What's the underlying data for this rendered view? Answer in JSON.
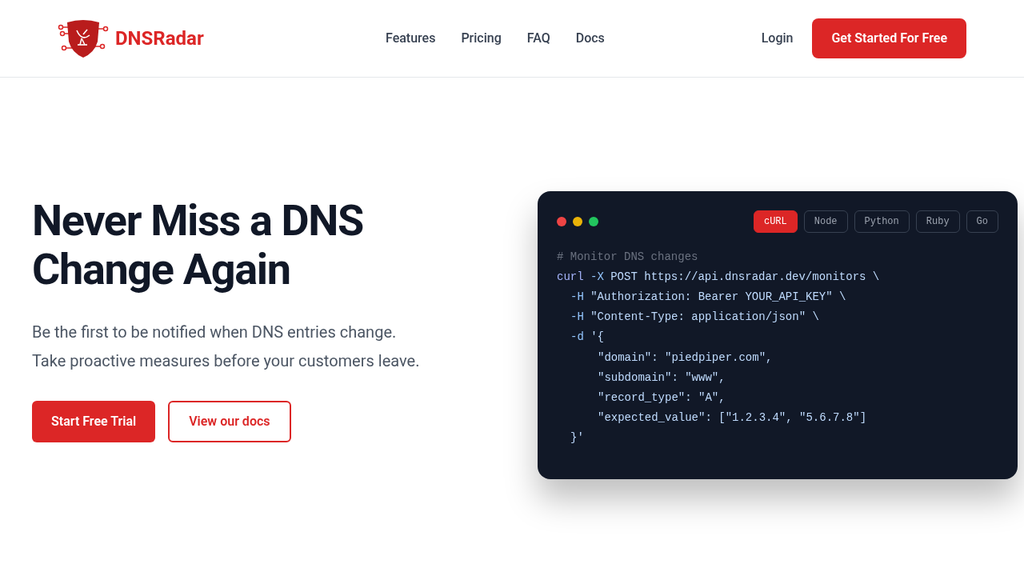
{
  "header": {
    "brand": "DNSRadar",
    "nav": [
      {
        "label": "Features"
      },
      {
        "label": "Pricing"
      },
      {
        "label": "FAQ"
      },
      {
        "label": "Docs"
      }
    ],
    "login": "Login",
    "cta": "Get Started For Free"
  },
  "hero": {
    "title_lines": [
      "Never Miss a DNS",
      "Change Again"
    ],
    "subtitle_lines": [
      "Be the first to be notified when DNS entries change.",
      "Take proactive measures before your customers leave."
    ],
    "primary_button": "Start Free Trial",
    "secondary_button": "View our docs"
  },
  "code_window": {
    "tabs": [
      {
        "label": "cURL",
        "selected": true
      },
      {
        "label": "Node",
        "selected": false
      },
      {
        "label": "Python",
        "selected": false
      },
      {
        "label": "Ruby",
        "selected": false
      },
      {
        "label": "Go",
        "selected": false
      }
    ],
    "lines": [
      {
        "kind": "top",
        "tokens": [
          {
            "kind": "comment",
            "text": "# Monitor DNS changes"
          }
        ]
      },
      {
        "kind": "top",
        "tokens": [
          {
            "kind": "keyword",
            "text": "curl"
          },
          {
            "kind": "flag",
            "text": " -X "
          },
          {
            "kind": "text",
            "text": "POST https://api.dnsradar.dev/monitors \\"
          }
        ]
      },
      {
        "kind": "option",
        "tokens": [
          {
            "kind": "flag",
            "text": "-H "
          },
          {
            "kind": "text",
            "text": "\"Authorization: Bearer YOUR_API_KEY\" \\"
          }
        ]
      },
      {
        "kind": "option",
        "tokens": [
          {
            "kind": "flag",
            "text": "-H "
          },
          {
            "kind": "text",
            "text": "\"Content-Type: application/json\" \\"
          }
        ]
      },
      {
        "kind": "option",
        "tokens": [
          {
            "kind": "flag",
            "text": "-d "
          },
          {
            "kind": "text",
            "text": "'{"
          }
        ]
      },
      {
        "kind": "body",
        "tokens": [
          {
            "kind": "text",
            "text": "\"domain\": \"piedpiper.com\","
          }
        ]
      },
      {
        "kind": "body",
        "tokens": [
          {
            "kind": "text",
            "text": "\"subdomain\": \"www\","
          }
        ]
      },
      {
        "kind": "body",
        "tokens": [
          {
            "kind": "text",
            "text": "\"record_type\": \"A\","
          }
        ]
      },
      {
        "kind": "body",
        "tokens": [
          {
            "kind": "text",
            "text": "\"expected_value\": [\"1.2.3.4\", \"5.6.7.8\"]"
          }
        ]
      },
      {
        "kind": "option",
        "tokens": [
          {
            "kind": "text",
            "text": "}'"
          }
        ]
      }
    ]
  }
}
